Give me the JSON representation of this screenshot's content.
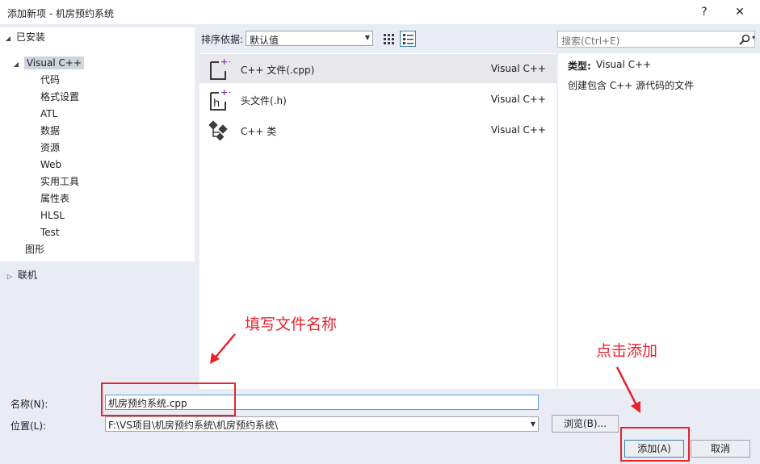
{
  "window": {
    "title": "添加新项 - 机房预约系统",
    "help_label": "?",
    "close_label": "✕"
  },
  "tree": {
    "installed": "已安装",
    "visual_cpp": "Visual C++",
    "children": [
      "代码",
      "格式设置",
      "ATL",
      "数据",
      "资源",
      "Web",
      "实用工具",
      "属性表",
      "HLSL",
      "Test"
    ],
    "graphics": "图形",
    "online": "联机"
  },
  "toolbar": {
    "sort_label": "排序依据:",
    "sort_value": "默认值",
    "search_placeholder": "搜索(Ctrl+E)"
  },
  "templates": [
    {
      "name": "C++ 文件(.cpp)",
      "type": "Visual C++",
      "icon": "cpp-file-icon"
    },
    {
      "name": "头文件(.h)",
      "type": "Visual C++",
      "icon": "header-file-icon"
    },
    {
      "name": "C++ 类",
      "type": "Visual C++",
      "icon": "cpp-class-icon"
    }
  ],
  "description": {
    "type_label": "类型:",
    "type_value": "Visual C++",
    "text": "创建包含 C++ 源代码的文件"
  },
  "form": {
    "name_label": "名称(N):",
    "name_value": "机房预约系统.cpp",
    "location_label": "位置(L):",
    "location_value": "F:\\VS项目\\机房预约系统\\机房预约系统\\",
    "browse_label": "浏览(B)...",
    "add_label": "添加(A)",
    "cancel_label": "取消"
  },
  "annotations": {
    "fill_name": "填写文件名称",
    "click_add": "点击添加"
  },
  "colors": {
    "annotation_red": "#e8232c",
    "icon_purple": "#8a3ab9",
    "dialog_bg": "#e9ecf5"
  }
}
